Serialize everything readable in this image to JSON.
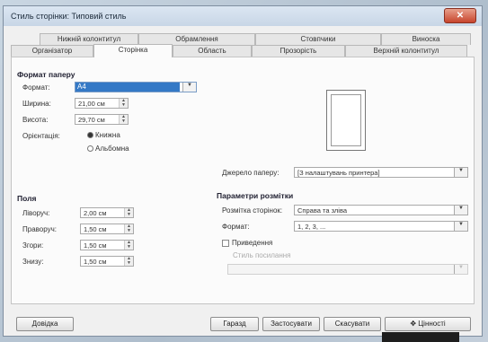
{
  "window": {
    "title": "Стиль сторінки: Типовий стиль",
    "close_icon": "close-icon"
  },
  "tabs_top": [
    "Нижній колонтитул",
    "Обрамлення",
    "Стовпчики",
    "Виноска"
  ],
  "tabs_bottom": [
    "Організатор",
    "Сторінка",
    "Область",
    "Прозорість",
    "Верхній колонтитул"
  ],
  "active_tab": "Сторінка",
  "paper_format": {
    "title": "Формат паперу",
    "format_label": "Формат:",
    "format_value": "A4",
    "width_label": "Ширина:",
    "width_value": "21,00 см",
    "height_label": "Висота:",
    "height_value": "29,70 см",
    "orientation_label": "Орієнтація:",
    "portrait_label": "Книжна",
    "landscape_label": "Альбомна"
  },
  "paper_tray": {
    "label": "Джерело паперу:",
    "value": "[З налаштувань принтера]"
  },
  "margins": {
    "title": "Поля",
    "left_label": "Ліворуч:",
    "left_value": "2,00 см",
    "right_label": "Праворуч:",
    "right_value": "1,50 см",
    "top_label": "Згори:",
    "top_value": "1,50 см",
    "bottom_label": "Знизу:",
    "bottom_value": "1,50 см"
  },
  "layout": {
    "title": "Параметри розмітки",
    "page_layout_label": "Розмітка сторінок:",
    "page_layout_value": "Справа та зліва",
    "format_label": "Формат:",
    "format_value": "1, 2, 3, ...",
    "register_label": "Приведення",
    "reference_style_label": "Стиль посилання",
    "reference_style_value": ""
  },
  "buttons": {
    "help": "Довідка",
    "ok": "Гаразд",
    "reset": "Застосувати",
    "cancel": "Скасувати",
    "restore": "Цінності"
  }
}
